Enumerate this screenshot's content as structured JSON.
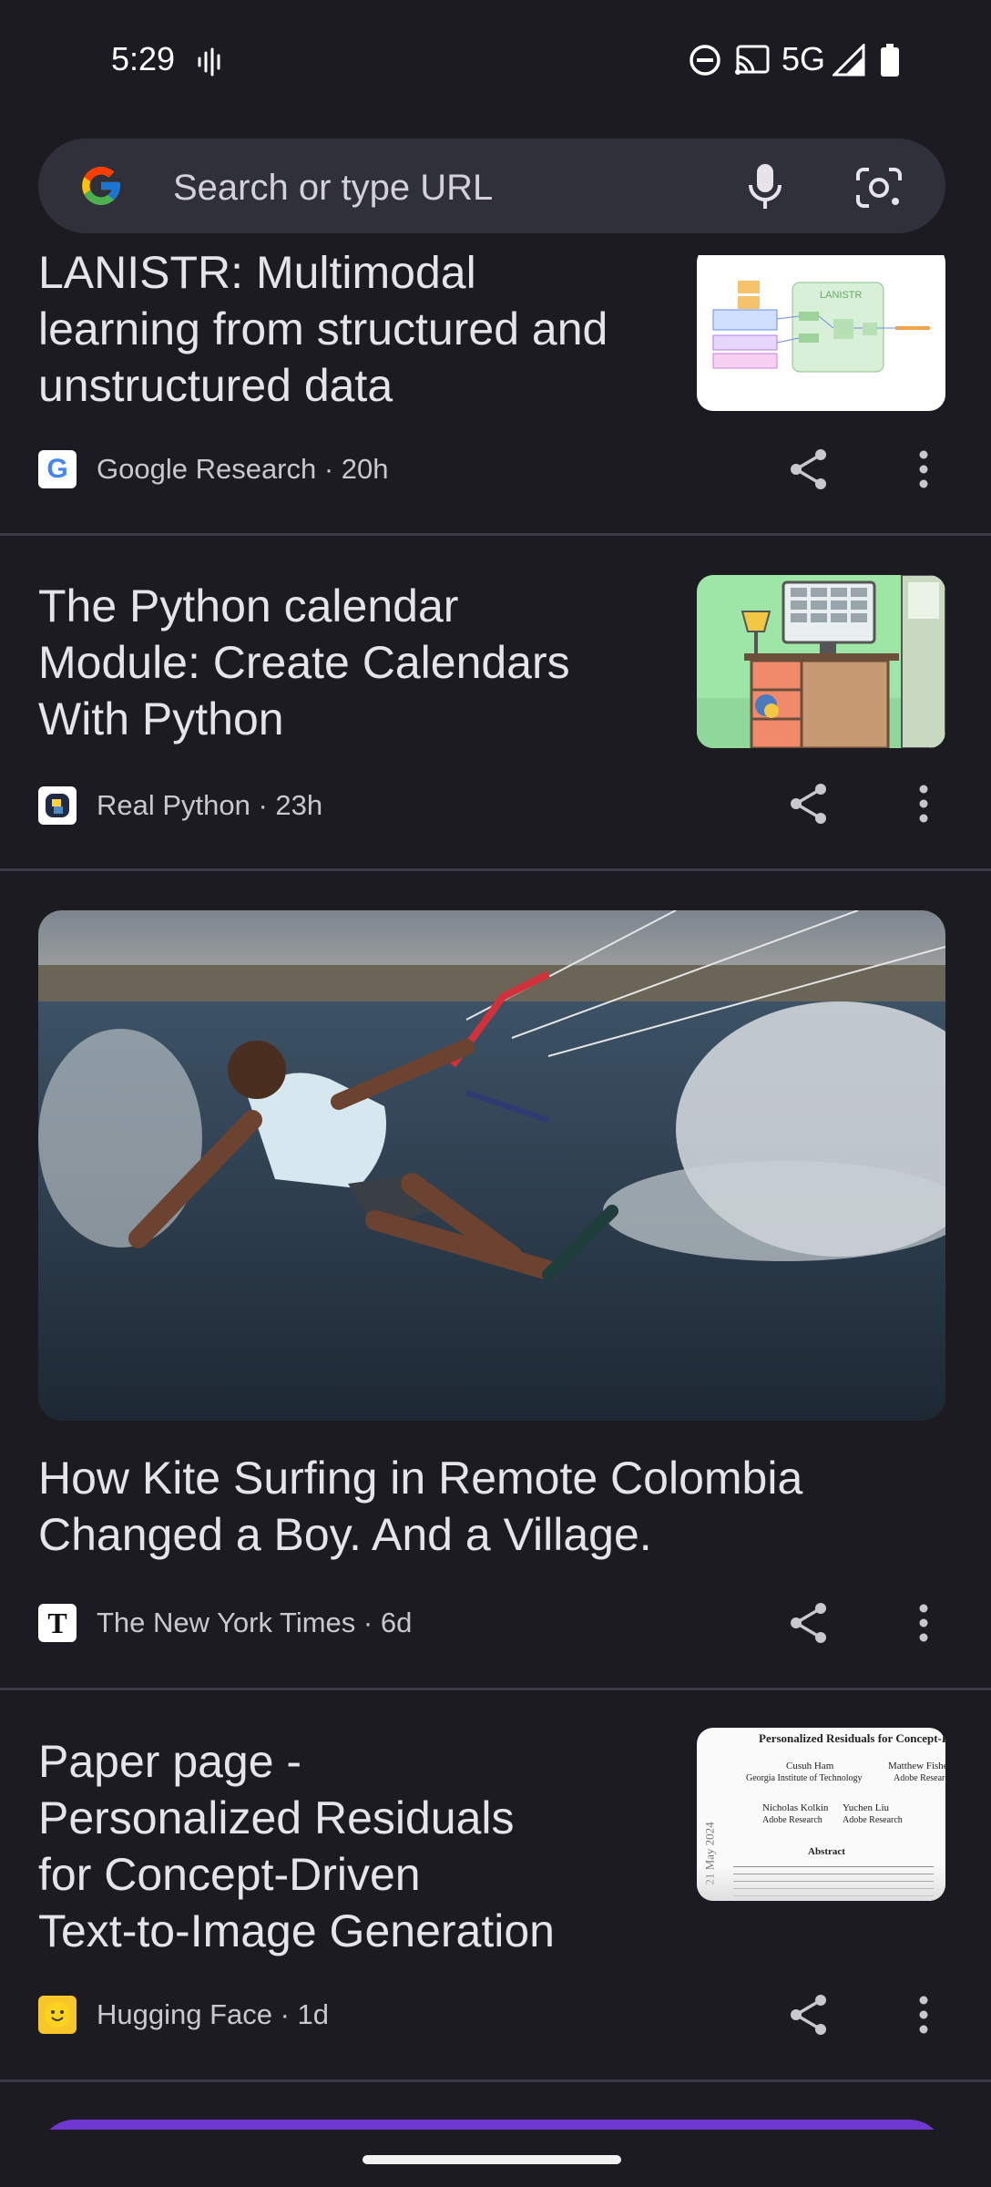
{
  "status_bar": {
    "time": "5:29",
    "network": "5G",
    "icons": [
      "voice-wave-icon",
      "do-not-disturb-icon",
      "cast-icon",
      "signal-icon",
      "battery-icon"
    ]
  },
  "search": {
    "placeholder": "Search or type URL",
    "icons": [
      "google-logo",
      "mic-icon",
      "lens-camera-icon"
    ]
  },
  "articles": [
    {
      "title_lines": [
        "LANISTR: Multimodal",
        "learning from structured and",
        "unstructured data"
      ],
      "source": "Google Research",
      "age": "20h",
      "meta": "Google Research · 20h",
      "thumbnail": {
        "label": "LANISTR"
      }
    },
    {
      "title_lines": [
        "The Python calendar",
        "Module: Create Calendars",
        "With Python"
      ],
      "source": "Real Python",
      "age": "23h",
      "meta": "Real Python · 23h"
    },
    {
      "title_lines": [
        "How Kite Surfing in Remote Colombia",
        "Changed a Boy. And a Village."
      ],
      "source": "The New York Times",
      "age": "6d",
      "meta": "The New York Times · 6d"
    },
    {
      "title_lines": [
        "Paper page -",
        "Personalized Residuals",
        "for Concept-Driven",
        "Text-to-Image Generation"
      ],
      "source": "Hugging Face",
      "age": "1d",
      "meta": "Hugging Face · 1d",
      "thumbnail": {
        "heading": "Personalized Residuals for Concept-Dr",
        "author1": "Cusuh Ham",
        "affil1": "Georgia Institute of Technology",
        "author2": "Matthew Fishe",
        "affil2": "Adobe Research",
        "author3": "Nicholas Kolkin",
        "author4": "Yuchen Liu",
        "affil3": "Adobe Research",
        "section": "Abstract",
        "date": "21 May 2024"
      }
    }
  ],
  "colors": {
    "background": "#1b1b21",
    "search_bg": "#30303a",
    "divider": "#3a3a44",
    "promo": "#6f39d1"
  }
}
